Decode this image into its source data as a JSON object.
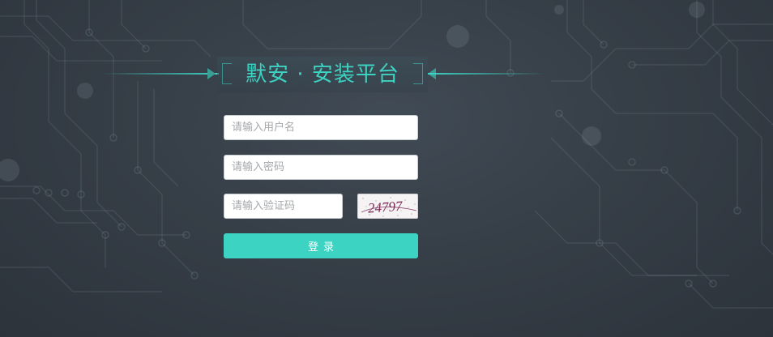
{
  "header": {
    "title": "默安 · 安装平台"
  },
  "login_form": {
    "username_placeholder": "请输入用户名",
    "password_placeholder": "请输入密码",
    "captcha_placeholder": "请输入验证码",
    "captcha_code": "24797",
    "submit_label": "登录"
  },
  "colors": {
    "accent": "#3dd3c2",
    "background": "#363e47",
    "captcha_text": "#7a2a55"
  }
}
